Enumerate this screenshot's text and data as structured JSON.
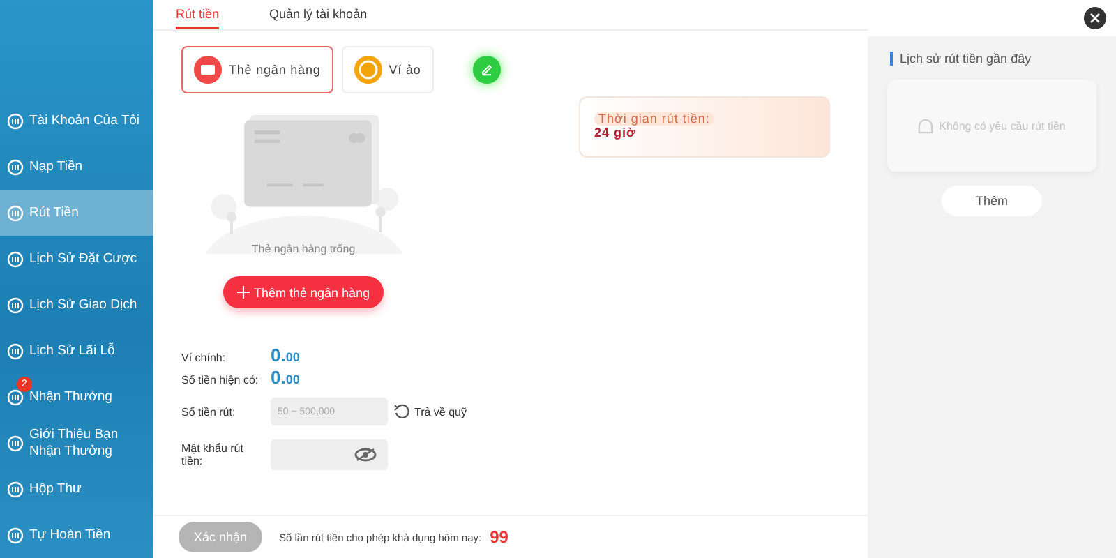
{
  "sidebar": {
    "items": [
      {
        "label": "Tài Khoản Của Tôi",
        "selected": false
      },
      {
        "label": "Nạp Tiền",
        "selected": false
      },
      {
        "label": "Rút Tiền",
        "selected": true
      },
      {
        "label": "Lịch Sử Đặt Cược",
        "selected": false
      },
      {
        "label": "Lịch Sử Giao Dịch",
        "selected": false
      },
      {
        "label": "Lịch Sử Lãi Lỗ",
        "selected": false
      },
      {
        "label": "Nhận Thưởng",
        "selected": false,
        "badge": "2"
      },
      {
        "label": "Giới Thiệu Bạn Nhận Thưởng",
        "selected": false
      },
      {
        "label": "Hộp Thư",
        "selected": false
      },
      {
        "label": "Tự Hoàn Tiền",
        "selected": false
      }
    ]
  },
  "tabs": [
    {
      "label": "Rút tiền",
      "selected": true
    },
    {
      "label": "Quản lý tài khoản",
      "selected": false
    }
  ],
  "methods": [
    {
      "kind": "card",
      "label": "Thẻ ngân hàng",
      "selected": true
    },
    {
      "kind": "coin",
      "label": "Ví ảo",
      "selected": false
    },
    {
      "kind": "edit",
      "selected": false
    }
  ],
  "empty_card": {
    "caption": "Thẻ ngân hàng trống",
    "button": "Thêm thẻ ngân hàng"
  },
  "notice": {
    "label": "Thời gian rút tiền:",
    "value": "24 giờ"
  },
  "balances": [
    {
      "label": "Ví chính:",
      "whole": "0.",
      "decimals": "00"
    },
    {
      "label": "Số tiền hiện có:",
      "whole": "0.",
      "decimals": "00"
    }
  ],
  "amount": {
    "label": "Số tiền rút:",
    "placeholder": "50 ~ 500,000",
    "action": "Trả về quỹ"
  },
  "password": {
    "label": "Mật khẩu rút tiền:"
  },
  "submit": {
    "label": "Xác nhận",
    "disabled": true
  },
  "limit": {
    "text": "Số lần rút tiền cho phép khả dụng hôm nay:",
    "count": "99"
  },
  "history": {
    "title": "Lịch sử rút tiền gần đây",
    "empty": "Không có yêu cầu rút tiền",
    "more": "Thêm"
  }
}
